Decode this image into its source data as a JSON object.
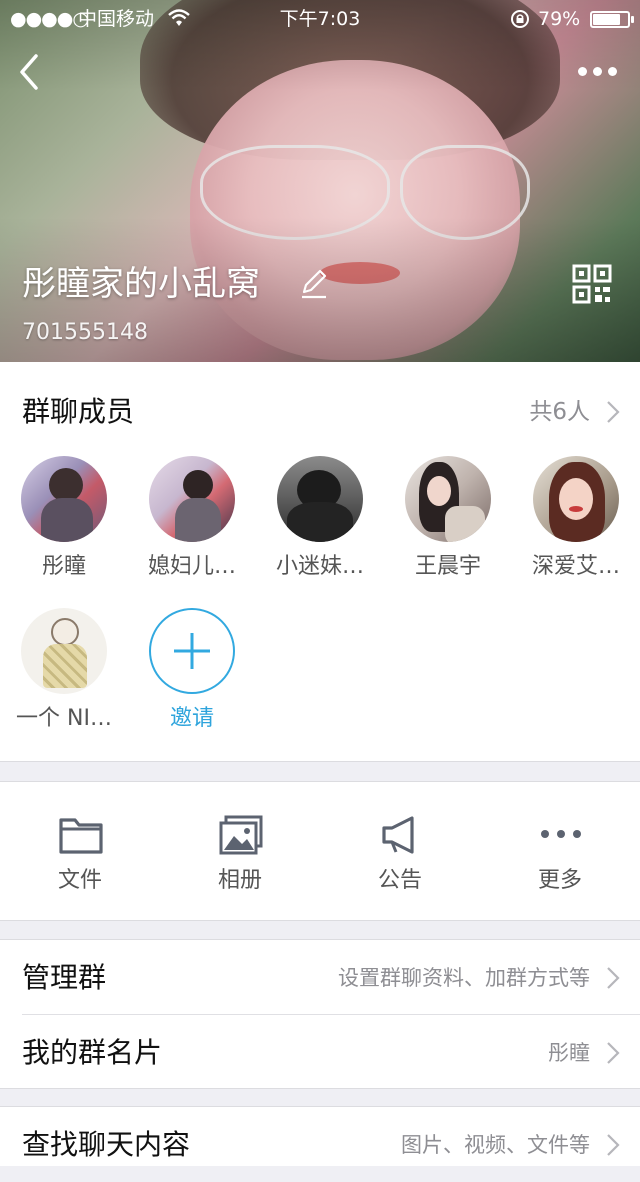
{
  "status_bar": {
    "signal": "●●●●○",
    "carrier": "中国移动",
    "time": "下午7:03",
    "battery": "79%",
    "battery_level": 0.79
  },
  "header": {
    "group_name": "彤瞳家的小乱窝",
    "group_id": "701555148"
  },
  "members": {
    "title": "群聊成员",
    "count_label": "共6人",
    "items": [
      {
        "name": "彤瞳"
      },
      {
        "name": "媳妇儿…"
      },
      {
        "name": "小迷妹…"
      },
      {
        "name": "王晨宇"
      },
      {
        "name": "深爱艾…"
      },
      {
        "name": "一个 NI…"
      }
    ],
    "invite_label": "邀请"
  },
  "tools": {
    "items": [
      {
        "label": "文件",
        "icon": "folder-icon"
      },
      {
        "label": "相册",
        "icon": "album-icon"
      },
      {
        "label": "公告",
        "icon": "megaphone-icon"
      },
      {
        "label": "更多",
        "icon": "more-dots-icon"
      }
    ]
  },
  "settings": {
    "manage_title": "管理群",
    "manage_value": "设置群聊资料、加群方式等",
    "card_title": "我的群名片",
    "card_value": "彤瞳",
    "search_title": "查找聊天内容",
    "search_value": "图片、视频、文件等"
  },
  "colors": {
    "accent": "#2ea4dc",
    "icon_gray": "#5c6370",
    "background": "#efeff4"
  }
}
